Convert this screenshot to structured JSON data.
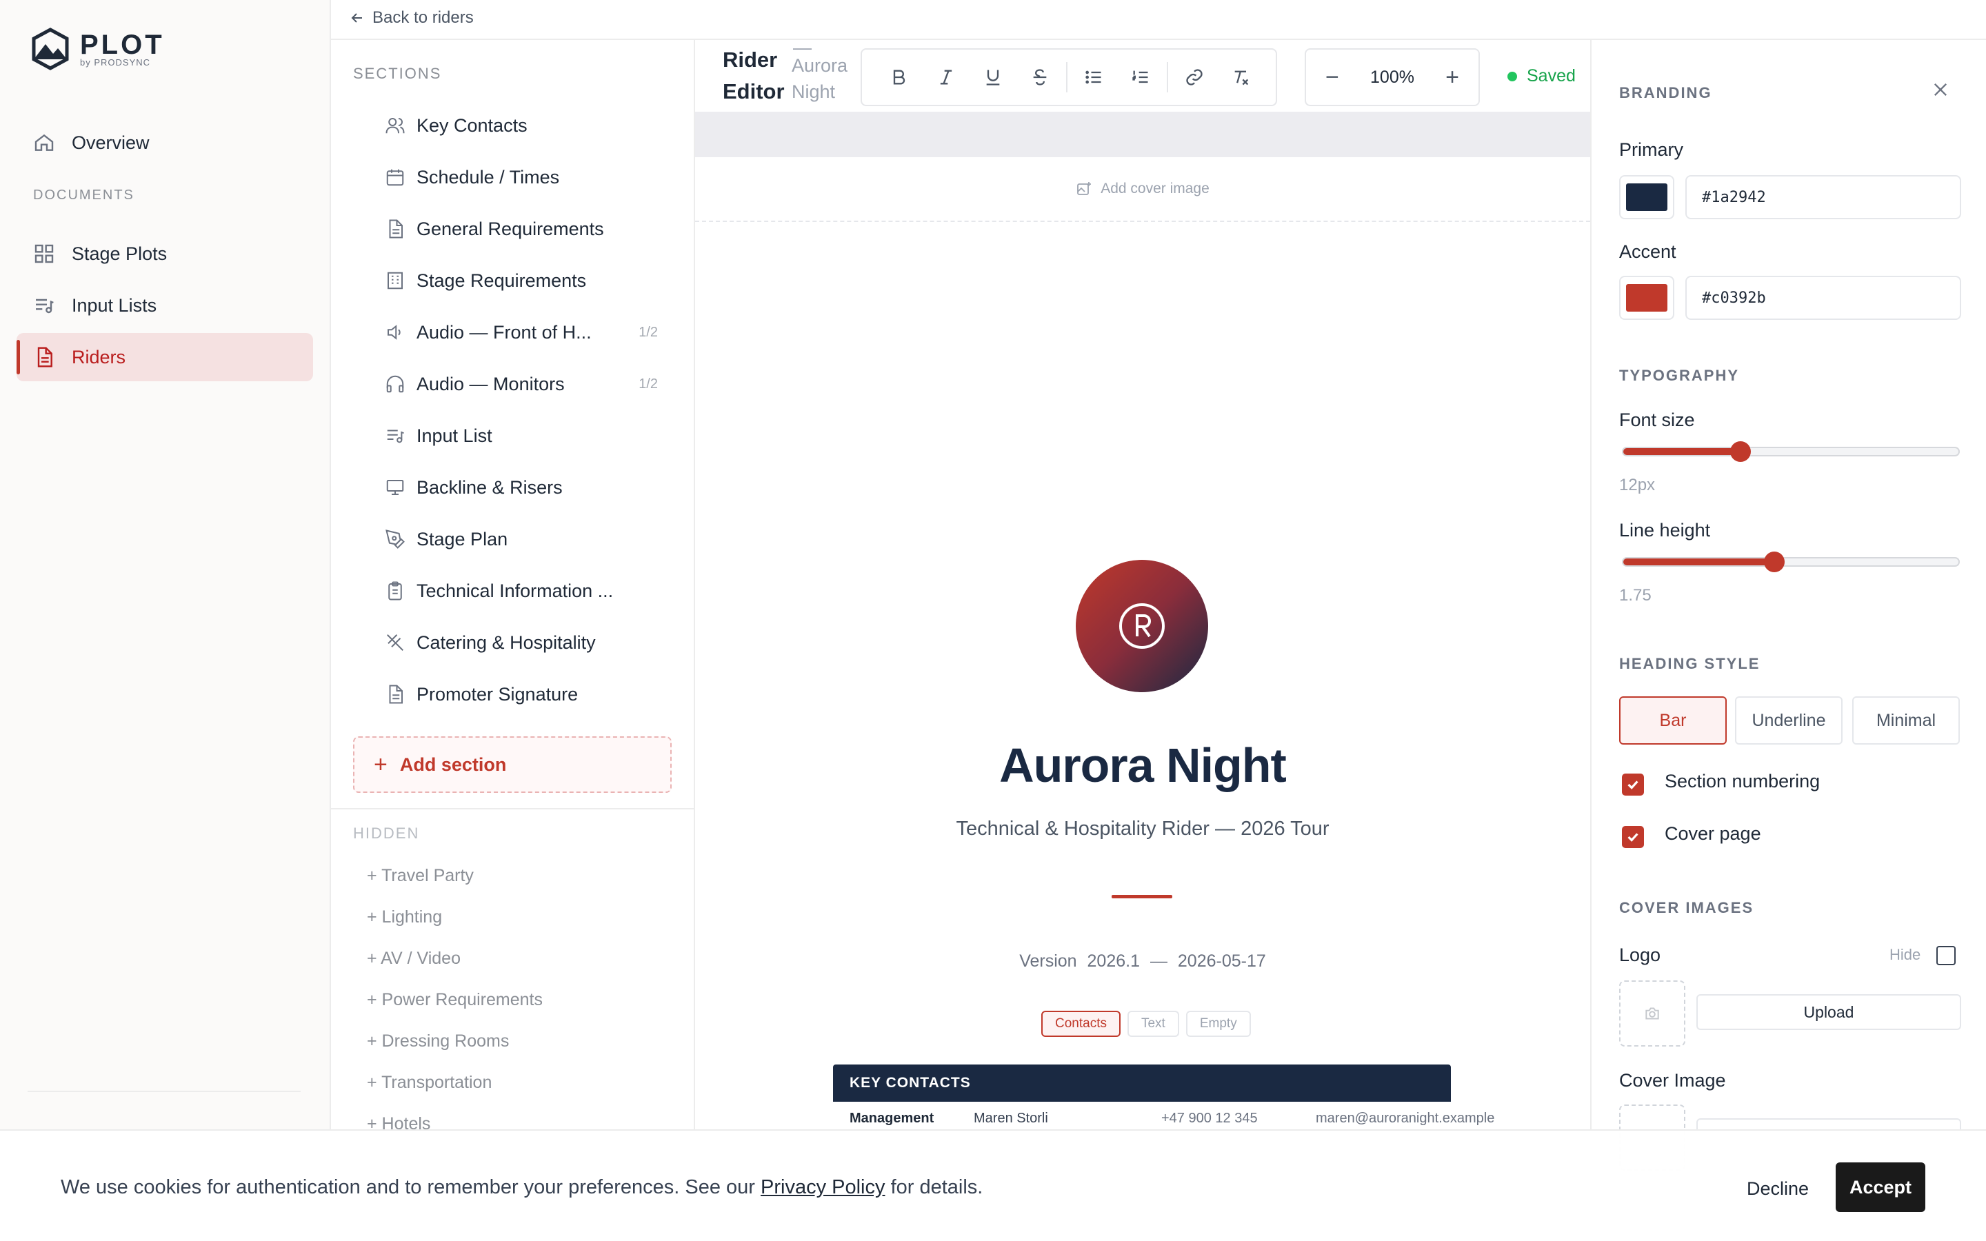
{
  "app": {
    "logo_title": "PLOT",
    "logo_sub": "by PRODSYNC",
    "accent": "#c0392b"
  },
  "nav": {
    "overview": "Overview",
    "documents_heading": "DOCUMENTS",
    "items": [
      {
        "label": "Stage Plots",
        "icon": "grid-icon"
      },
      {
        "label": "Input Lists",
        "icon": "list-music-icon"
      },
      {
        "label": "Riders",
        "icon": "document-icon",
        "active": true
      }
    ]
  },
  "topbar": {
    "back_label": "Back to riders"
  },
  "sections": {
    "heading": "SECTIONS",
    "items": [
      {
        "label": "Key Contacts",
        "icon": "users-icon"
      },
      {
        "label": "Schedule / Times",
        "icon": "calendar-icon"
      },
      {
        "label": "General Requirements",
        "icon": "document-icon"
      },
      {
        "label": "Stage Requirements",
        "icon": "building-icon"
      },
      {
        "label": "Audio — Front of H...",
        "icon": "speaker-icon",
        "pages": "1/2"
      },
      {
        "label": "Audio — Monitors",
        "icon": "headphones-icon",
        "pages": "1/2"
      },
      {
        "label": "Input List",
        "icon": "list-music-icon"
      },
      {
        "label": "Backline & Risers",
        "icon": "monitor-icon"
      },
      {
        "label": "Stage Plan",
        "icon": "pen-tool-icon"
      },
      {
        "label": "Technical Information ...",
        "icon": "clipboard-icon"
      },
      {
        "label": "Catering & Hospitality",
        "icon": "utensils-icon"
      },
      {
        "label": "Promoter Signature",
        "icon": "document-icon"
      }
    ],
    "add_label": "Add section",
    "hidden_heading": "HIDDEN",
    "hidden_items": [
      "+ Travel Party",
      "+ Lighting",
      "+ AV / Video",
      "+ Power Requirements",
      "+ Dressing Rooms",
      "+ Transportation",
      "+ Hotels"
    ]
  },
  "editor": {
    "title": "Rider Editor",
    "subtitle_dash": "—",
    "subtitle": "Aurora Night",
    "zoom": "100%",
    "saved": "Saved",
    "add_cover": "Add cover image",
    "doc": {
      "title": "Aurora Night",
      "subtitle": "Technical & Hospitality Rider — 2026 Tour",
      "version_label": "Version",
      "version": "2026.1",
      "sep": "—",
      "date": "2026-05-17",
      "pills": [
        "Contacts",
        "Text",
        "Empty"
      ],
      "contacts_heading": "KEY CONTACTS",
      "contacts": [
        {
          "role": "Management",
          "name": "Maren Storli",
          "phone": "+47 900 12 345",
          "email": "maren@auroranight.example"
        }
      ]
    }
  },
  "branding": {
    "heading": "BRANDING",
    "primary_label": "Primary",
    "primary": "#1a2942",
    "accent_label": "Accent",
    "accent": "#c0392b",
    "typography_heading": "TYPOGRAPHY",
    "font_size_label": "Font size",
    "font_size": "12px",
    "font_size_fraction": 0.35,
    "line_height_label": "Line height",
    "line_height": "1.75",
    "line_height_fraction": 0.45,
    "heading_style_heading": "HEADING STYLE",
    "heading_styles": [
      "Bar",
      "Underline",
      "Minimal"
    ],
    "section_numbering": "Section numbering",
    "cover_page": "Cover page",
    "cover_images_heading": "COVER IMAGES",
    "logo_label": "Logo",
    "hide_label": "Hide",
    "upload_label": "Upload",
    "cover_image_label": "Cover Image"
  },
  "cookie": {
    "text_before": "We use cookies for authentication and to remember your preferences. See our ",
    "link": "Privacy Policy",
    "text_after": " for details.",
    "decline": "Decline",
    "accept": "Accept"
  }
}
